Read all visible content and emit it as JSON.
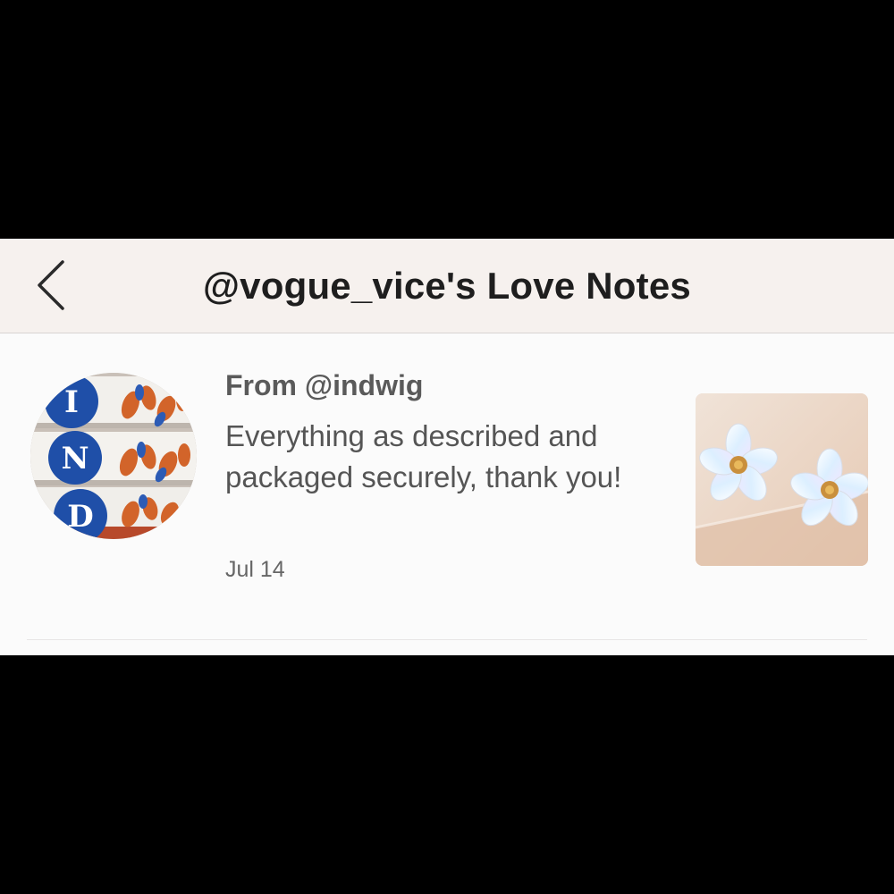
{
  "header": {
    "title": "@vogue_vice's Love Notes",
    "back_icon": "chevron-left-icon"
  },
  "notes": [
    {
      "from": "From @indwig",
      "message": "Everything as described and packaged securely, thank you!",
      "date": "Jul 14",
      "avatar_letters": [
        "I",
        "N",
        "D"
      ],
      "product_image": "flower-earrings"
    }
  ],
  "colors": {
    "header_bg": "#f6f1ee",
    "screen_bg": "#fbfbfb",
    "title_text": "#1e1e1e",
    "body_text": "#555555",
    "avatar_blue": "#1f4fa8",
    "avatar_orange": "#d2642a"
  }
}
